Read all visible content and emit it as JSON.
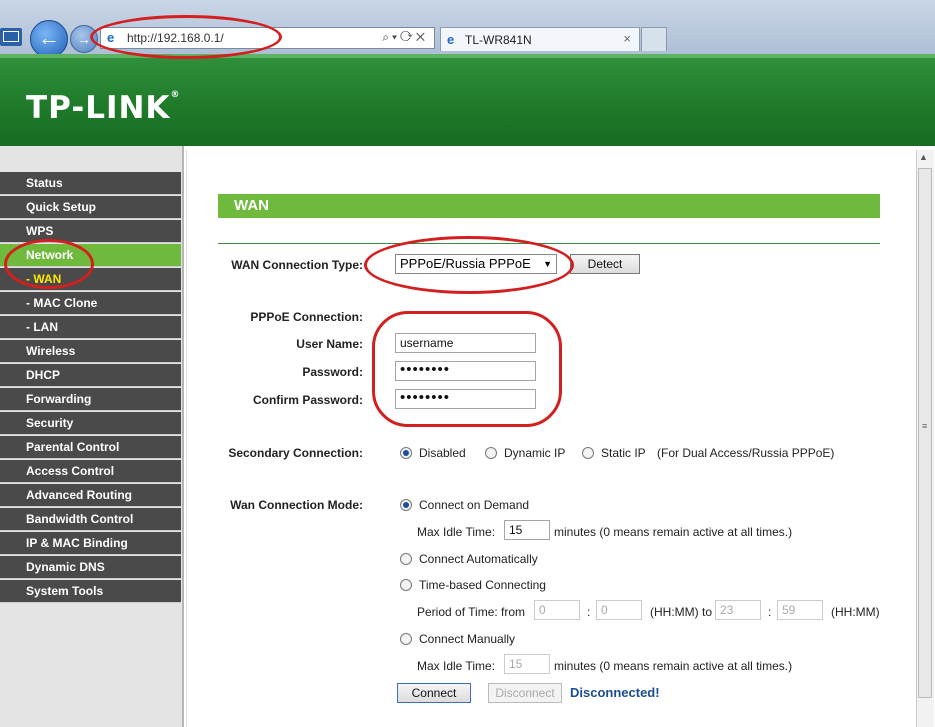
{
  "browser": {
    "url": "http://192.168.0.1/",
    "tab_title": "TL-WR841N",
    "tab_close": "×",
    "nav_back": "←"
  },
  "header": {
    "logo": "TP-LINK",
    "logo_mark": "®"
  },
  "sidebar": {
    "items": [
      {
        "label": "Status"
      },
      {
        "label": "Quick Setup"
      },
      {
        "label": "WPS"
      },
      {
        "label": "Network"
      },
      {
        "label": "- WAN"
      },
      {
        "label": "- MAC Clone"
      },
      {
        "label": "- LAN"
      },
      {
        "label": "Wireless"
      },
      {
        "label": "DHCP"
      },
      {
        "label": "Forwarding"
      },
      {
        "label": "Security"
      },
      {
        "label": "Parental Control"
      },
      {
        "label": "Access Control"
      },
      {
        "label": "Advanced Routing"
      },
      {
        "label": "Bandwidth Control"
      },
      {
        "label": "IP & MAC Binding"
      },
      {
        "label": "Dynamic DNS"
      },
      {
        "label": "System Tools"
      }
    ]
  },
  "main": {
    "section_title": "WAN",
    "wan_type_label": "WAN Connection Type:",
    "wan_type_value": "PPPoE/Russia PPPoE",
    "detect_button": "Detect",
    "pppoe_label": "PPPoE Connection:",
    "username_label": "User Name:",
    "username_value": "username",
    "password_label": "Password:",
    "password_value": "••••••••",
    "confirm_label": "Confirm Password:",
    "confirm_value": "••••••••",
    "secondary_label": "Secondary Connection:",
    "secondary_options": [
      "Disabled",
      "Dynamic IP",
      "Static IP"
    ],
    "secondary_note": "(For Dual Access/Russia PPPoE)",
    "mode_label": "Wan Connection Mode:",
    "mode_on_demand": "Connect on Demand",
    "max_idle_label": "Max Idle Time:",
    "max_idle_value": "15",
    "max_idle_unit": "minutes (0 means remain active at all times.)",
    "mode_auto": "Connect Automatically",
    "mode_time": "Time-based Connecting",
    "period_label": "Period of Time: from",
    "from_hh": "0",
    "from_mm": "0",
    "hhmm_to": "(HH:MM) to",
    "to_hh": "23",
    "to_mm": "59",
    "hhmm": "(HH:MM)",
    "colon": ":",
    "mode_manual": "Connect Manually",
    "max_idle_value2": "15",
    "connect_button": "Connect",
    "disconnect_button": "Disconnect",
    "status_text": "Disconnected!"
  }
}
